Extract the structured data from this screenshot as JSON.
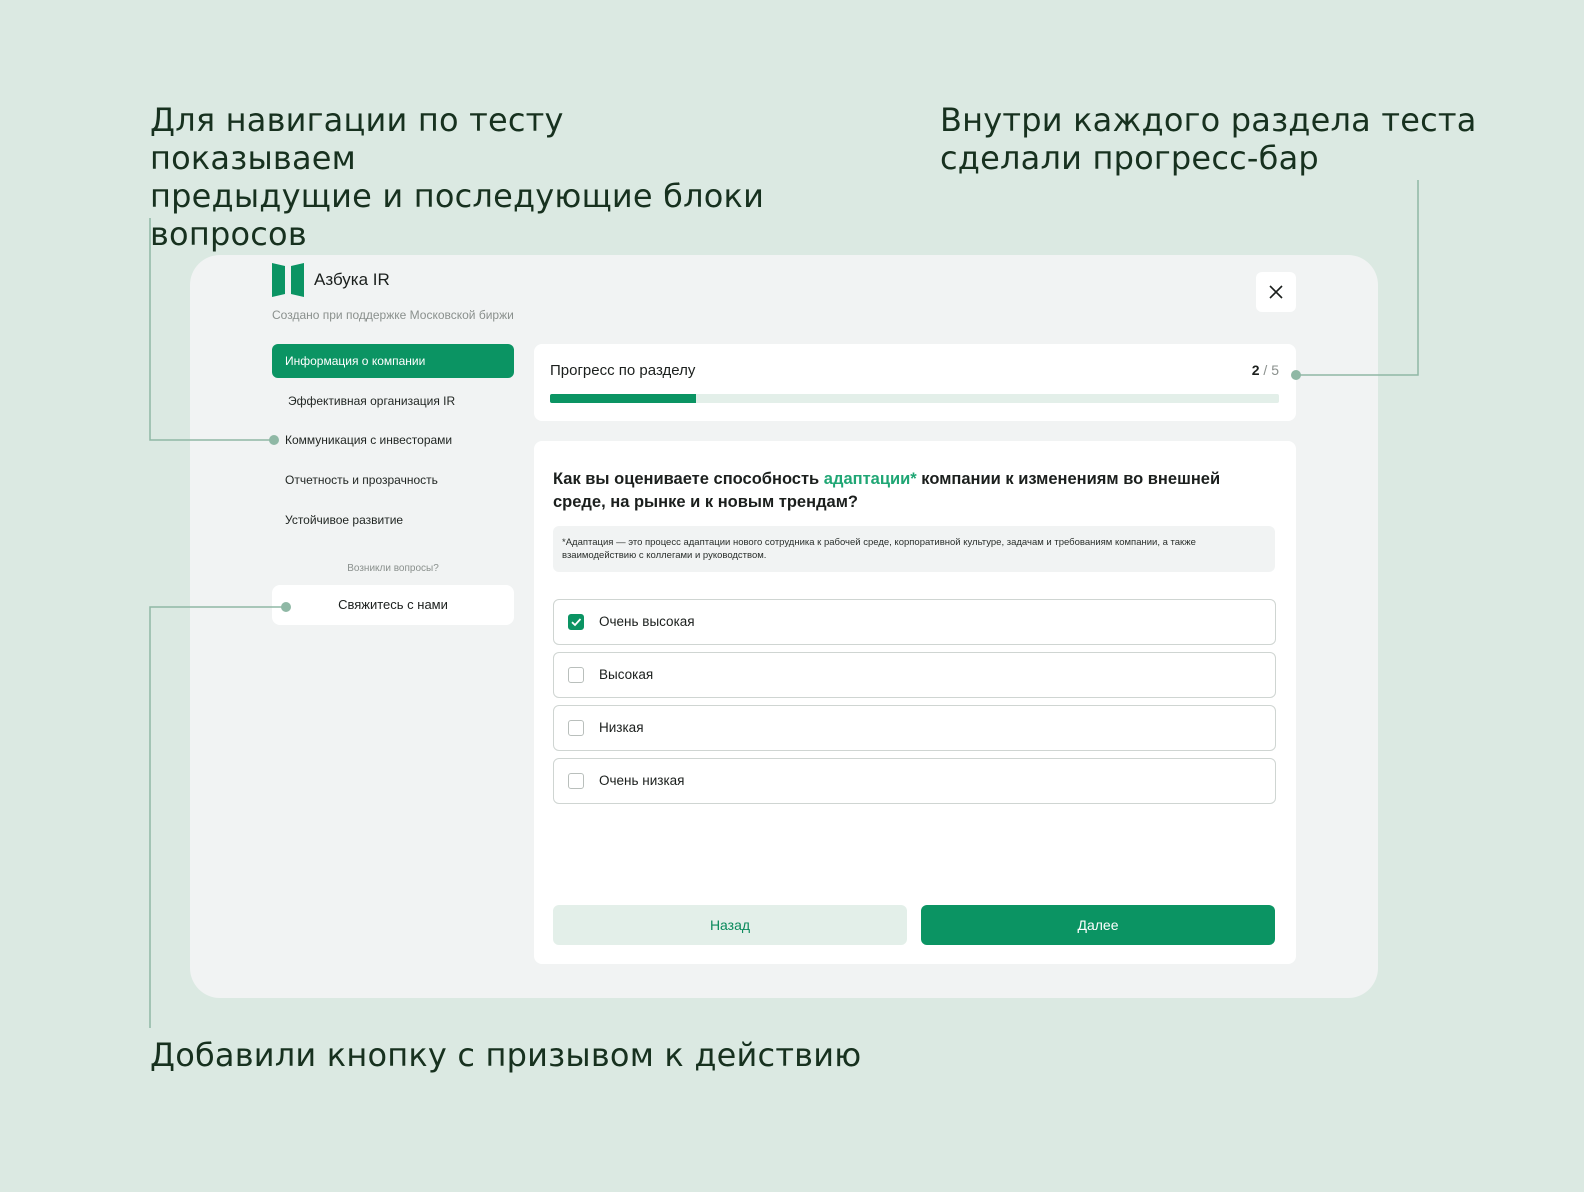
{
  "captions": {
    "nav": "Для навигации по тесту показываем\nпредыдущие и последующие блоки\nвопросов",
    "progress": "Внутри каждого раздела теста\nсделали прогресс-бар",
    "cta": "Добавили кнопку с призывом к действию"
  },
  "header": {
    "brand": "Азбука IR",
    "subtitle": "Создано при поддержке Московской биржи",
    "close_icon": "close-icon"
  },
  "nav": {
    "items": [
      {
        "label": "Информация о компании",
        "active": true
      },
      {
        "label": "Эффективная организация IR",
        "active": false
      },
      {
        "label": "Коммуникация с инвесторами",
        "active": false
      },
      {
        "label": "Отчетность и прозрачность",
        "active": false
      },
      {
        "label": "Устойчивое развитие",
        "active": false
      }
    ],
    "help_text": "Возникли вопросы?",
    "contact_label": "Свяжитесь с нами"
  },
  "progress": {
    "title": "Прогресс по разделу",
    "current": "2",
    "separator": " / ",
    "total": "5",
    "fill_fraction": 0.2
  },
  "question": {
    "text_before": "Как вы оцениваете способность ",
    "highlight": "адаптации*",
    "text_after": " компании к изменениям во внешней среде, на рынке и к новым трендам?",
    "note": "*Адаптация — это процесс адаптации нового сотрудника к рабочей среде, корпоративной культуре, задачам и требованиям компании,  а также взаимодействию с коллегами и руководством.",
    "options": [
      {
        "label": "Очень высокая",
        "checked": true
      },
      {
        "label": "Высокая",
        "checked": false
      },
      {
        "label": "Низкая",
        "checked": false
      },
      {
        "label": "Очень низкая",
        "checked": false
      }
    ]
  },
  "actions": {
    "back_label": "Назад",
    "next_label": "Далее"
  },
  "colors": {
    "accent": "#0b9463",
    "background": "#dbe9e2",
    "callout_line": "#8fb8a5"
  }
}
